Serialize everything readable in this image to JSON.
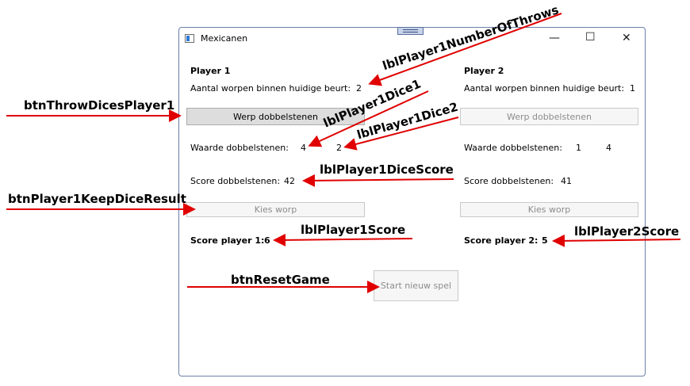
{
  "window": {
    "title": "Mexicanen",
    "controls": {
      "minimize": "—",
      "maximize": "☐",
      "close": "✕"
    }
  },
  "player1": {
    "header": "Player 1",
    "throws_label": "Aantal worpen binnen huidige beurt:",
    "throws_value": "2",
    "throw_button": "Werp dobbelstenen",
    "dice_label": "Waarde dobbelstenen:",
    "dice1": "4",
    "dice2": "2",
    "dice_score_label": "Score dobbelstenen:",
    "dice_score": "42",
    "keep_button": "Kies worp",
    "score_label": "Score player 1:",
    "score": "6"
  },
  "player2": {
    "header": "Player 2",
    "throws_label": "Aantal worpen binnen huidige beurt:",
    "throws_value": "1",
    "throw_button": "Werp dobbelstenen",
    "dice_label": "Waarde dobbelstenen:",
    "dice1": "1",
    "dice2": "4",
    "dice_score_label": "Score dobbelstenen:",
    "dice_score": "41",
    "keep_button": "Kies worp",
    "score_label": "Score player 2:",
    "score": "5"
  },
  "reset_button": "Start nieuw spel",
  "annotations": {
    "btnThrowDicesPlayer1": "btnThrowDicesPlayer1",
    "btnPlayer1KeepDiceResult": "btnPlayer1KeepDiceResult",
    "btnResetGame": "btnResetGame",
    "lblPlayer1NumberOfThrows": "lblPlayer1NumberOfThrows",
    "lblPlayer1Dice1": "lblPlayer1Dice1",
    "lblPlayer1Dice2": "lblPlayer1Dice2",
    "lblPlayer1DiceScore": "lblPlayer1DiceScore",
    "lblPlayer1Score": "lblPlayer1Score",
    "lblPlayer2Score": "lblPlayer2Score"
  },
  "colors": {
    "arrow": "#e00000",
    "window_border": "#6b7fa8"
  }
}
